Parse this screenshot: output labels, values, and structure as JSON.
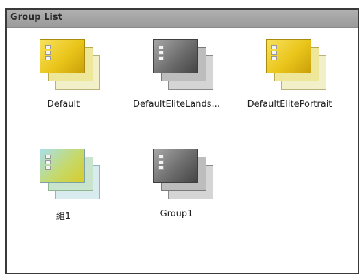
{
  "panel": {
    "title": "Group List"
  },
  "groups": [
    {
      "label": "Default",
      "icon": "group-yellow-icon",
      "color": "#eac51a"
    },
    {
      "label": "DefaultEliteLands...",
      "icon": "group-gray-icon",
      "color": "#6d6d6d"
    },
    {
      "label": "DefaultElitePortrait",
      "icon": "group-yellow-icon",
      "color": "#eac51a"
    },
    {
      "label": "組1",
      "icon": "group-teal-icon",
      "color": "#a9dfe9"
    },
    {
      "label": "Group1",
      "icon": "group-gray-icon",
      "color": "#6d6d6d"
    }
  ]
}
